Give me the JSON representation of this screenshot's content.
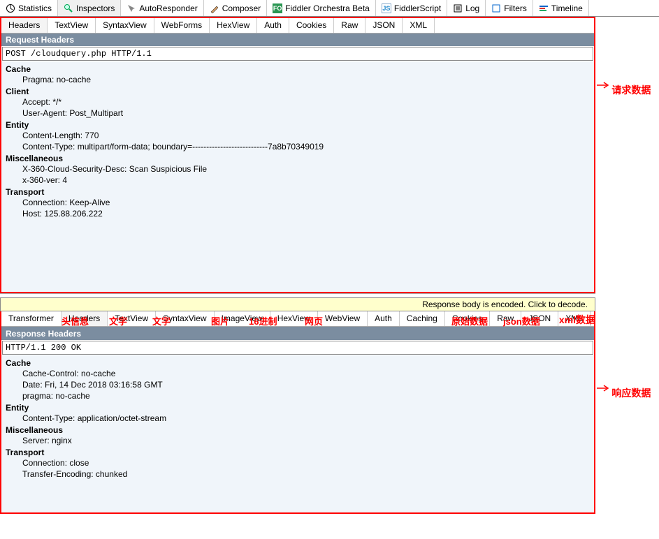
{
  "top_tabs": {
    "statistics": "Statistics",
    "inspectors": "Inspectors",
    "autoresponder": "AutoResponder",
    "composer": "Composer",
    "orchestra": "Fiddler Orchestra Beta",
    "script": "FiddlerScript",
    "log": "Log",
    "filters": "Filters",
    "timeline": "Timeline"
  },
  "req_tabs": {
    "headers": "Headers",
    "textview": "TextView",
    "syntaxview": "SyntaxView",
    "webforms": "WebForms",
    "hexview": "HexView",
    "auth": "Auth",
    "cookies": "Cookies",
    "raw": "Raw",
    "json": "JSON",
    "xml": "XML"
  },
  "req": {
    "header_title": "Request Headers",
    "line": "POST /cloudquery.php HTTP/1.1",
    "groups": [
      {
        "title": "Cache",
        "items": [
          "Pragma: no-cache"
        ]
      },
      {
        "title": "Client",
        "items": [
          "Accept: */*",
          "User-Agent: Post_Multipart"
        ]
      },
      {
        "title": "Entity",
        "items": [
          "Content-Length: 770",
          "Content-Type: multipart/form-data; boundary=---------------------------7a8b70349019"
        ]
      },
      {
        "title": "Miscellaneous",
        "items": [
          "X-360-Cloud-Security-Desc: Scan Suspicious File",
          "x-360-ver: 4"
        ]
      },
      {
        "title": "Transport",
        "items": [
          "Connection: Keep-Alive",
          "Host: 125.88.206.222"
        ]
      }
    ]
  },
  "decode_banner": "Response body is encoded. Click to decode.",
  "resp_tabs": {
    "transformer": "Transformer",
    "headers": "Headers",
    "textview": "TextView",
    "syntaxview": "SyntaxView",
    "imageview": "ImageView",
    "hexview": "HexView",
    "webview": "WebView",
    "auth": "Auth",
    "caching": "Caching",
    "cookies": "Cookies",
    "raw": "Raw",
    "json": "JSON",
    "xml": "XML"
  },
  "resp": {
    "header_title": "Response Headers",
    "line": "HTTP/1.1 200 OK",
    "groups": [
      {
        "title": "Cache",
        "items": [
          "Cache-Control: no-cache",
          "Date: Fri, 14 Dec 2018 03:16:58 GMT",
          "pragma: no-cache"
        ]
      },
      {
        "title": "Entity",
        "items": [
          "Content-Type: application/octet-stream"
        ]
      },
      {
        "title": "Miscellaneous",
        "items": [
          "Server: nginx"
        ]
      },
      {
        "title": "Transport",
        "items": [
          "Connection: close",
          "Transfer-Encoding: chunked"
        ]
      }
    ]
  },
  "annotations": {
    "req": "请求数据",
    "resp": "响应数据",
    "xml": "xml数据",
    "head": "头信息",
    "text1": "文字",
    "text2": "文字",
    "image": "图片",
    "hex": "16进制",
    "web": "网页",
    "raw": "原始数据",
    "json": "json数据"
  }
}
